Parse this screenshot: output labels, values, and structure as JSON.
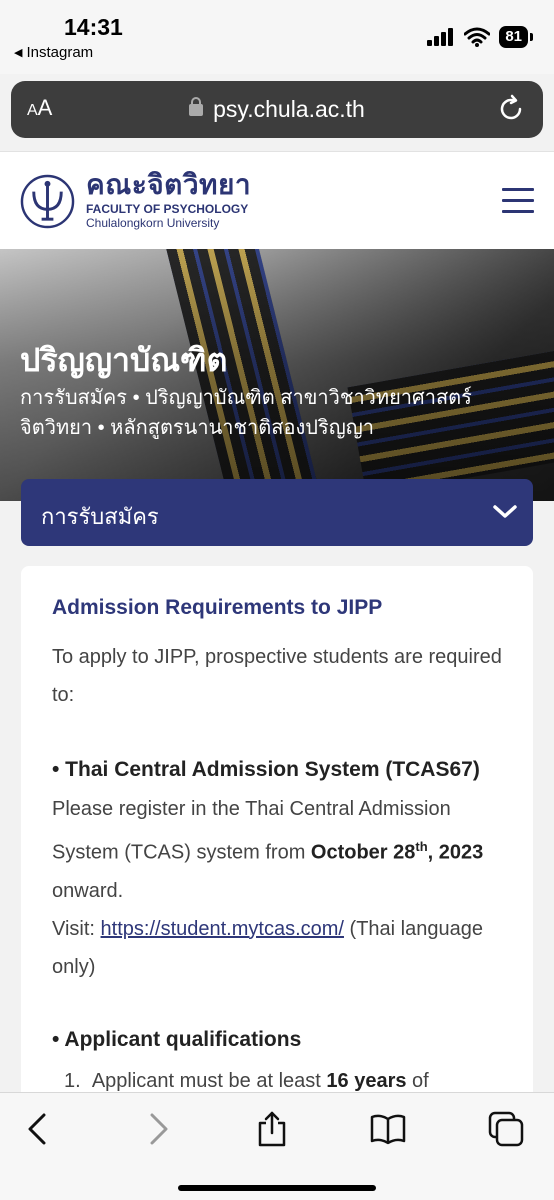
{
  "status_bar": {
    "time": "14:31",
    "back_app": "Instagram",
    "battery": "81"
  },
  "browser": {
    "text_size_label": "AA",
    "url": "psy.chula.ac.th"
  },
  "site": {
    "logo_thai": "คณะจิตวิทยา",
    "logo_en_line1": "FACULTY OF PSYCHOLOGY",
    "logo_en_line2": "Chulalongkorn University"
  },
  "hero": {
    "title": "ปริญญาบัณฑิต",
    "breadcrumb": "การรับสมัคร • ปริญญาบัณฑิต สาขาวิชาวิทยาศาสตร์จิตวิทยา • หลักสูตรนานาชาติสองปริญญา"
  },
  "dropdown": {
    "selected": "การรับสมัคร"
  },
  "content": {
    "heading": "Admission Requirements to JIPP",
    "intro": "To apply to JIPP, prospective students are required to:",
    "tcas_title": "• Thai Central Admission System (TCAS67)",
    "tcas_text_1": "Please register in the Thai Central Admission System (TCAS) system from ",
    "tcas_date_month": "October 28",
    "tcas_date_sup": "th",
    "tcas_date_year": ", 2023",
    "tcas_text_2": " onward.",
    "visit_label": "Visit: ",
    "visit_link": "https://student.mytcas.com/",
    "visit_note": " (Thai language only)",
    "qual_title": "• Applicant qualifications",
    "qual_item_number": "1.",
    "qual_item_text": "Applicant must be at least ",
    "qual_item_bold": "16 years",
    "qual_item_tail": " of"
  },
  "colors": {
    "brand_navy": "#2e3779",
    "url_bar": "#3d3d3d"
  },
  "icons": [
    "signal-icon",
    "wifi-icon",
    "lock-icon",
    "reload-icon",
    "hamburger-icon",
    "chevron-down-icon",
    "back-icon",
    "forward-icon",
    "share-icon",
    "bookmarks-icon",
    "tabs-icon"
  ]
}
